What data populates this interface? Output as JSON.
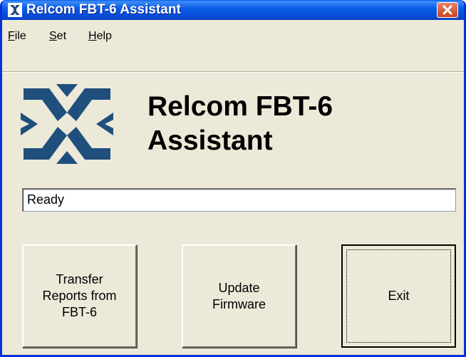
{
  "window": {
    "title": "Relcom FBT-6 Assistant"
  },
  "menu": [
    {
      "label": "File"
    },
    {
      "label": "Set"
    },
    {
      "label": "Help"
    }
  ],
  "heading": {
    "line1": "Relcom FBT-6",
    "line2": "Assistant"
  },
  "status": {
    "text": "Ready"
  },
  "buttons": {
    "transfer": {
      "line1": "Transfer",
      "line2": "Reports from",
      "line3": "FBT-6"
    },
    "update": {
      "line1": "Update",
      "line2": "Firmware"
    },
    "exit": {
      "label": "Exit"
    }
  },
  "colors": {
    "titlebar": "#0a58e0",
    "close_button": "#d9542f",
    "logo": "#1f4f7d",
    "window_bg": "#ece9d8"
  },
  "icons": {
    "app": "relcom-logo-icon",
    "close": "close-icon"
  }
}
